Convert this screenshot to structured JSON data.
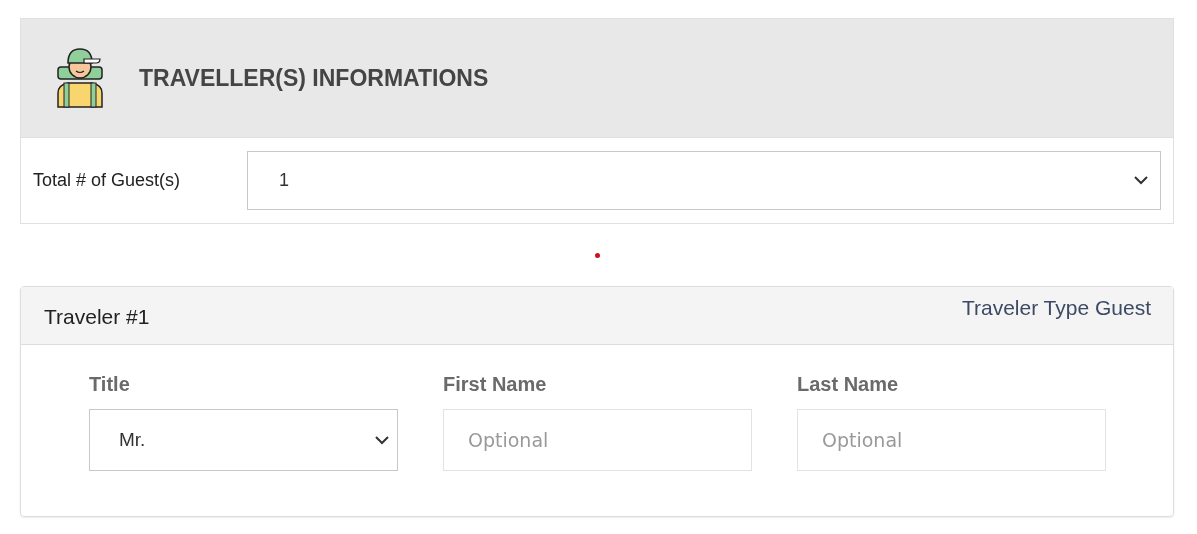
{
  "header": {
    "title": "TRAVELLER(S) INFORMATIONS"
  },
  "guests": {
    "label": "Total # of Guest(s)",
    "value": "1"
  },
  "travelers": [
    {
      "title": "Traveler #1",
      "type": "Traveler Type Guest",
      "fields": [
        {
          "kind": "select",
          "label": "Title",
          "value": "Mr."
        },
        {
          "kind": "input",
          "label": "First Name",
          "placeholder": "Optional"
        },
        {
          "kind": "input",
          "label": "Last Name",
          "placeholder": "Optional"
        }
      ]
    }
  ]
}
